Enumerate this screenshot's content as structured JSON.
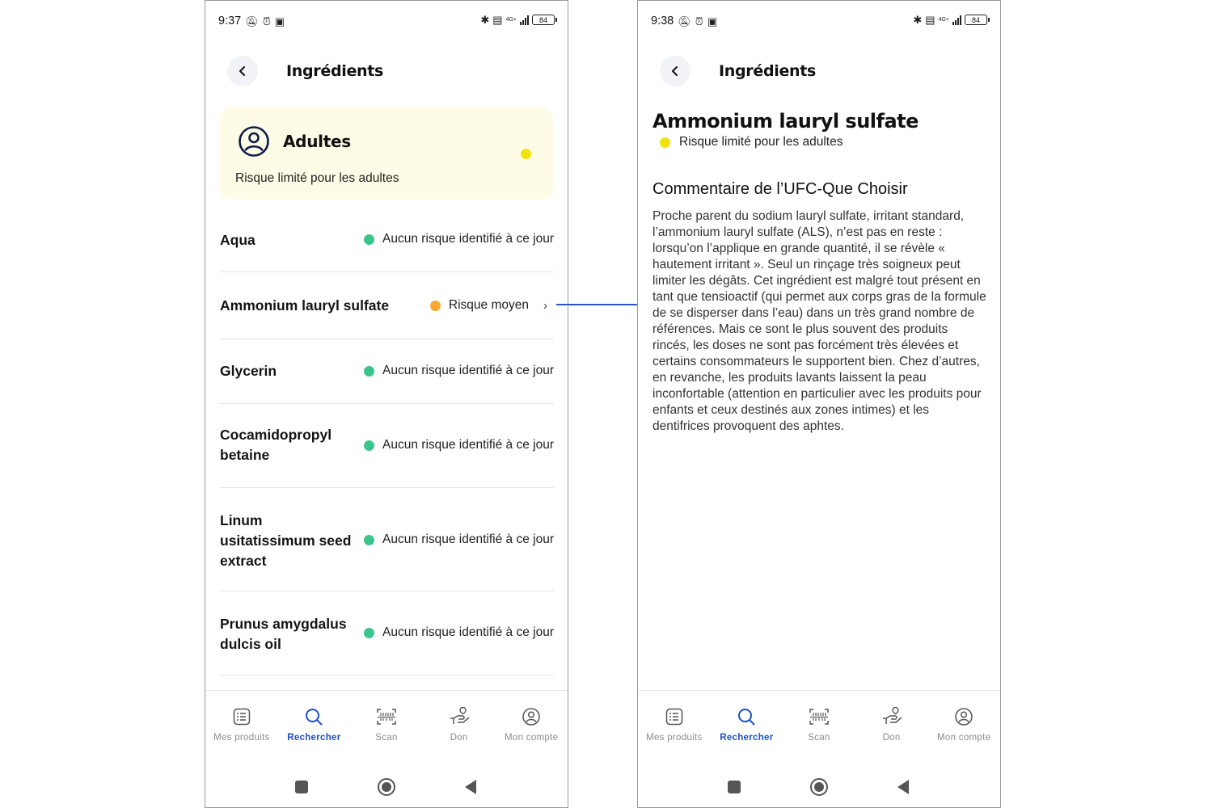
{
  "colors": {
    "accent": "#1f4fc4",
    "risk_none": "#3cc48d",
    "risk_medium": "#f6a933",
    "risk_limited": "#f1e30d",
    "card_bg": "#fefce6",
    "arrow": "#2a56c9"
  },
  "left_screen": {
    "status": {
      "time": "9:37",
      "battery": "84",
      "network": "4G+"
    },
    "header": {
      "title": "Ingrédients",
      "back_icon": "chevron-left-icon"
    },
    "risk_card": {
      "icon": "user-circle-icon",
      "title": "Adultes",
      "subtitle": "Risque limité pour les adultes",
      "level_color": "#f1e30d"
    },
    "ingredients": [
      {
        "name": "Aqua",
        "status": "Aucun risque identifié à ce jour",
        "level": "none",
        "clickable": false
      },
      {
        "name": "Ammonium lauryl sulfate",
        "status": "Risque moyen",
        "level": "medium",
        "clickable": true
      },
      {
        "name": "Glycerin",
        "status": "Aucun risque identifié à ce jour",
        "level": "none",
        "clickable": false
      },
      {
        "name": "Cocamidopropyl betaine",
        "status": "Aucun risque identifié à ce jour",
        "level": "none",
        "clickable": false
      },
      {
        "name": "Linum usitatissimum seed extract",
        "status": "Aucun risque identifié à ce jour",
        "level": "none",
        "clickable": false
      },
      {
        "name": "Prunus amygdalus dulcis oil",
        "status": "Aucun risque identifié à ce jour",
        "level": "none",
        "clickable": false
      }
    ]
  },
  "right_screen": {
    "status": {
      "time": "9:38",
      "battery": "84",
      "network": "4G+"
    },
    "header": {
      "title": "Ingrédients",
      "back_icon": "chevron-left-icon"
    },
    "detail": {
      "title": "Ammonium lauryl sulfate",
      "risk": "Risque limité pour les adultes",
      "comment_title": "Commentaire de l’UFC-Que Choisir",
      "comment_text": "Proche parent du sodium lauryl sulfate, irritant standard, l’ammonium lauryl sulfate (ALS), n’est pas en reste : lorsqu’on l’applique en grande quantité, il se révèle « hautement irritant ». Seul un rinçage très soigneux peut limiter les dégâts. Cet ingrédient est malgré tout présent en tant que tensioactif (qui permet aux corps gras de la formule de se disperser dans l’eau) dans un très grand nombre de références. Mais ce sont le plus souvent des produits rincés, les doses ne sont pas forcément très élevées et certains consommateurs le supportent bien. Chez d’autres, en revanche, les produits lavants laissent la peau inconfortable (attention en particulier avec les produits pour enfants et ceux destinés aux zones intimes) et les dentifrices provoquent des aphtes."
    }
  },
  "bottom_nav": [
    {
      "label": "Mes produits",
      "icon": "list-icon",
      "active": false
    },
    {
      "label": "Rechercher",
      "icon": "search-icon",
      "active": true
    },
    {
      "label": "Scan",
      "icon": "barcode-scan-icon",
      "active": false
    },
    {
      "label": "Don",
      "icon": "donate-hand-icon",
      "active": false
    },
    {
      "label": "Mon compte",
      "icon": "account-icon",
      "active": false
    }
  ],
  "system_nav": [
    {
      "icon": "recents-square-icon"
    },
    {
      "icon": "home-circle-icon"
    },
    {
      "icon": "back-triangle-icon"
    }
  ]
}
